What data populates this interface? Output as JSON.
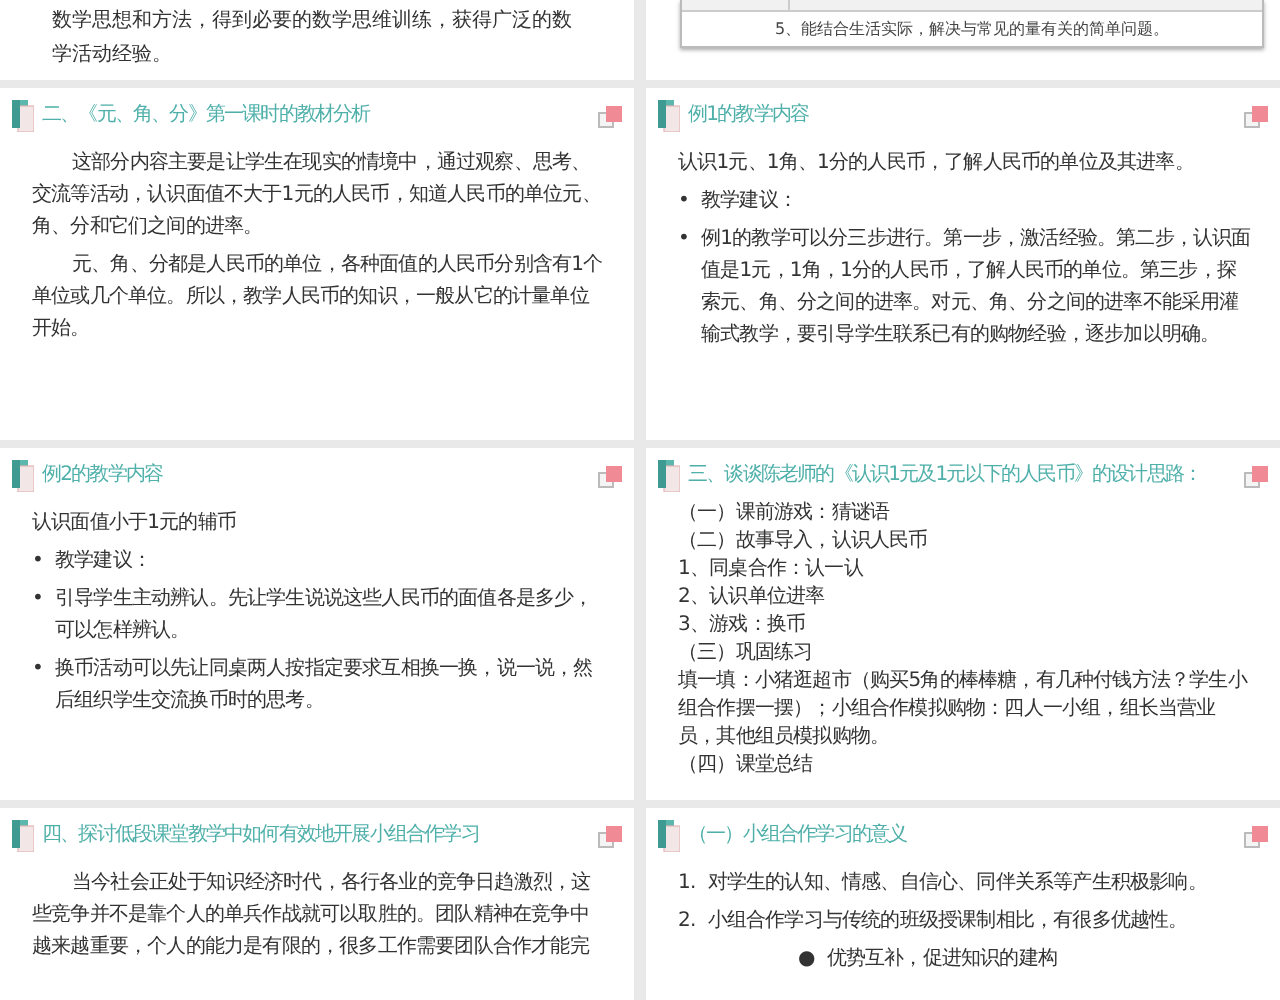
{
  "slides": [
    {
      "kind": "text_tail",
      "blocks": [
        {
          "kind": "plain",
          "text": "数学思想和方法，得到必要的数学思维训练，获得广泛的数学活动经验。"
        }
      ]
    },
    {
      "kind": "table_tail",
      "rows": [
        "5、能结合生活实际，解决与常见的量有关的简单问题。"
      ]
    },
    {
      "kind": "content",
      "title": "二、《元、角、分》第一课时的教材分析",
      "blocks": [
        {
          "kind": "para",
          "text": "这部分内容主要是让学生在现实的情境中，通过观察、思考、交流等活动，认识面值不大于1元的人民币，知道人民币的单位元、角、分和它们之间的进率。"
        },
        {
          "kind": "para",
          "text": "元、角、分都是人民币的单位，各种面值的人民币分别含有1个单位或几个单位。所以，教学人民币的知识，一般从它的计量单位开始。"
        }
      ]
    },
    {
      "kind": "content",
      "title": "例1的教学内容",
      "blocks": [
        {
          "kind": "plain",
          "text": "认识1元、1角、1分的人民币，了解人民币的单位及其进率。"
        },
        {
          "kind": "bullet",
          "marker": "•",
          "text": "教学建议："
        },
        {
          "kind": "bullet",
          "marker": "•",
          "text": "例1的教学可以分三步进行。第一步，激活经验。第二步，认识面值是1元，1角，1分的人民币，了解人民币的单位。第三步，探索元、角、分之间的进率。对元、角、分之间的进率不能采用灌输式教学，要引导学生联系已有的购物经验，逐步加以明确。"
        }
      ]
    },
    {
      "kind": "content",
      "title": "例2的教学内容",
      "blocks": [
        {
          "kind": "plain",
          "text": "认识面值小于1元的辅币"
        },
        {
          "kind": "bullet",
          "marker": "•",
          "text": "教学建议："
        },
        {
          "kind": "bullet",
          "marker": "•",
          "text": "引导学生主动辨认。先让学生说说这些人民币的面值各是多少，可以怎样辨认。"
        },
        {
          "kind": "bullet",
          "marker": "•",
          "text": "换币活动可以先让同桌两人按指定要求互相换一换，说一说，然后组织学生交流换币时的思考。"
        }
      ]
    },
    {
      "kind": "content",
      "title": "三、谈谈陈老师的《认识1元及1元以下的人民币》的设计思路：",
      "blocks": [
        {
          "kind": "line",
          "text": "（一）课前游戏：猜谜语"
        },
        {
          "kind": "line",
          "text": "（二）故事导入，认识人民币"
        },
        {
          "kind": "line",
          "text": "1、同桌合作：认一认"
        },
        {
          "kind": "line",
          "text": "2、认识单位进率"
        },
        {
          "kind": "line",
          "text": "3、游戏：换币"
        },
        {
          "kind": "line",
          "text": "（三）巩固练习"
        },
        {
          "kind": "line",
          "text": "填一填：小猪逛超市（购买5角的棒棒糖，有几种付钱方法？学生小组合作摆一摆）；小组合作模拟购物：四人一小组，组长当营业员，其他组员模拟购物。"
        },
        {
          "kind": "line",
          "text": "（四）课堂总结"
        }
      ]
    },
    {
      "kind": "content",
      "title": "四、探讨低段课堂教学中如何有效地开展小组合作学习",
      "blocks": [
        {
          "kind": "para",
          "text": "当今社会正处于知识经济时代，各行各业的竞争日趋激烈，这些竞争并不是靠个人的单兵作战就可以取胜的。团队精神在竞争中越来越重要，个人的能力是有限的，很多工作需要团队合作才能完"
        }
      ]
    },
    {
      "kind": "content",
      "title": "（一）小组合作学习的意义",
      "blocks": [
        {
          "kind": "numbered",
          "marker": "1.",
          "text": "对学生的认知、情感、自信心、同伴关系等产生积极影响。"
        },
        {
          "kind": "numbered",
          "marker": "2.",
          "text": "小组合作学习与传统的班级授课制相比，有很多优越性。"
        },
        {
          "kind": "dot",
          "marker": "●",
          "text": "优势互补，促进知识的建构"
        }
      ]
    }
  ]
}
